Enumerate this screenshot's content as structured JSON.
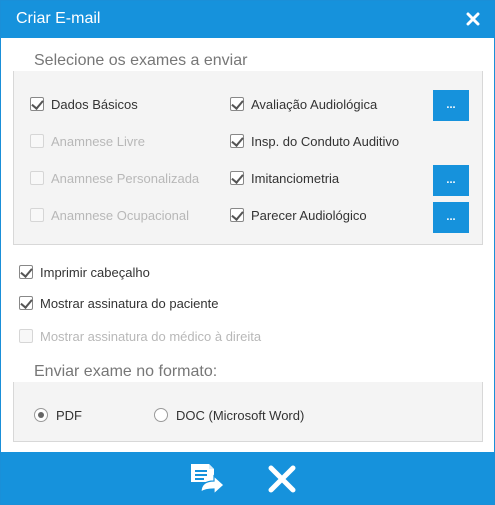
{
  "dialog": {
    "title": "Criar E-mail"
  },
  "exams": {
    "legend": "Selecione os exames a enviar",
    "left": [
      {
        "label": "Dados Básicos",
        "checked": true,
        "disabled": false
      },
      {
        "label": "Anamnese Livre",
        "checked": false,
        "disabled": true
      },
      {
        "label": "Anamnese Personalizada",
        "checked": false,
        "disabled": true
      },
      {
        "label": "Anamnese Ocupacional",
        "checked": false,
        "disabled": true
      }
    ],
    "right": [
      {
        "label": "Avaliação Audiológica",
        "checked": true,
        "has_button": true
      },
      {
        "label": "Insp. do Conduto Auditivo",
        "checked": true,
        "has_button": false
      },
      {
        "label": "Imitanciometria",
        "checked": true,
        "has_button": true
      },
      {
        "label": "Parecer Audiológico",
        "checked": true,
        "has_button": true
      }
    ],
    "button_label": "..."
  },
  "options": [
    {
      "label": "Imprimir cabeçalho",
      "checked": true,
      "disabled": false
    },
    {
      "label": "Mostrar assinatura do paciente",
      "checked": true,
      "disabled": false
    },
    {
      "label": "Mostrar assinatura do médico à direita",
      "checked": false,
      "disabled": true
    }
  ],
  "format": {
    "legend": "Enviar exame no formato:",
    "choices": [
      {
        "label": "PDF",
        "selected": true
      },
      {
        "label": "DOC (Microsoft Word)",
        "selected": false
      }
    ]
  },
  "footer": {
    "send_icon": "send-email-icon",
    "cancel_icon": "close-icon"
  },
  "colors": {
    "accent": "#1692dc"
  }
}
